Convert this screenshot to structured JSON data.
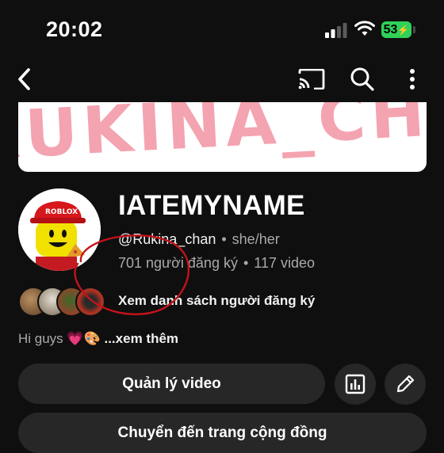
{
  "status": {
    "time": "20:02",
    "battery": "53"
  },
  "channel": {
    "name": "IATEMYNAME",
    "handle": "@Rukina_chan",
    "pronouns": "she/her",
    "subscribers": "701 người đăng ký",
    "videos": "117 video",
    "banner_text": "RUKINA_CHAN",
    "avatar_badge": "ROBLOX"
  },
  "subscribers_link": "Xem danh sách người đăng ký",
  "bio": {
    "text": "Hi guys 💗🎨",
    "more": "...xem thêm"
  },
  "buttons": {
    "manage_videos": "Quản lý video",
    "community": "Chuyển đến trang cộng đồng"
  },
  "icons": [
    "back-icon",
    "cast-icon",
    "search-icon",
    "more-vert-icon",
    "analytics-icon",
    "edit-pencil-icon"
  ],
  "colors": {
    "background": "#0f0f0f",
    "button": "#272727",
    "battery": "#30d158",
    "annotation": "#c4121a",
    "banner_text": "#f4a3b0"
  }
}
